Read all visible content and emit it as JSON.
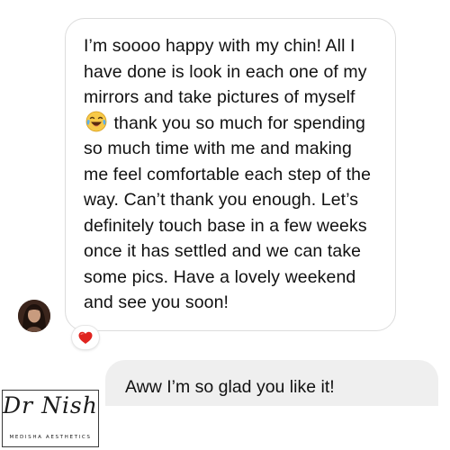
{
  "incoming_message": {
    "text_before_emoji": "I’m soooo happy with my chin! All I have done is look in each one of my mirrors and take pictures of myself",
    "emoji": "face-with-tears-of-joy-icon",
    "text_after_emoji": "thank you so much for spending so much time with me and making me feel comfortable each step of the way. Can’t thank you enough. Let’s definitely touch base in a few weeks once it has settled and we can take some pics. Have a lovely weekend and see you soon!",
    "reaction": "heart-icon"
  },
  "outgoing_message": {
    "text": "Aww I’m so glad you like it!"
  },
  "colors": {
    "incoming_bubble_border": "#dcdcdc",
    "outgoing_bubble_bg": "#efefef",
    "heart": "#e0241f",
    "text": "#111111"
  },
  "watermark": {
    "script": "Dr Nish",
    "subtitle": "MEDISHA AESTHETICS"
  }
}
